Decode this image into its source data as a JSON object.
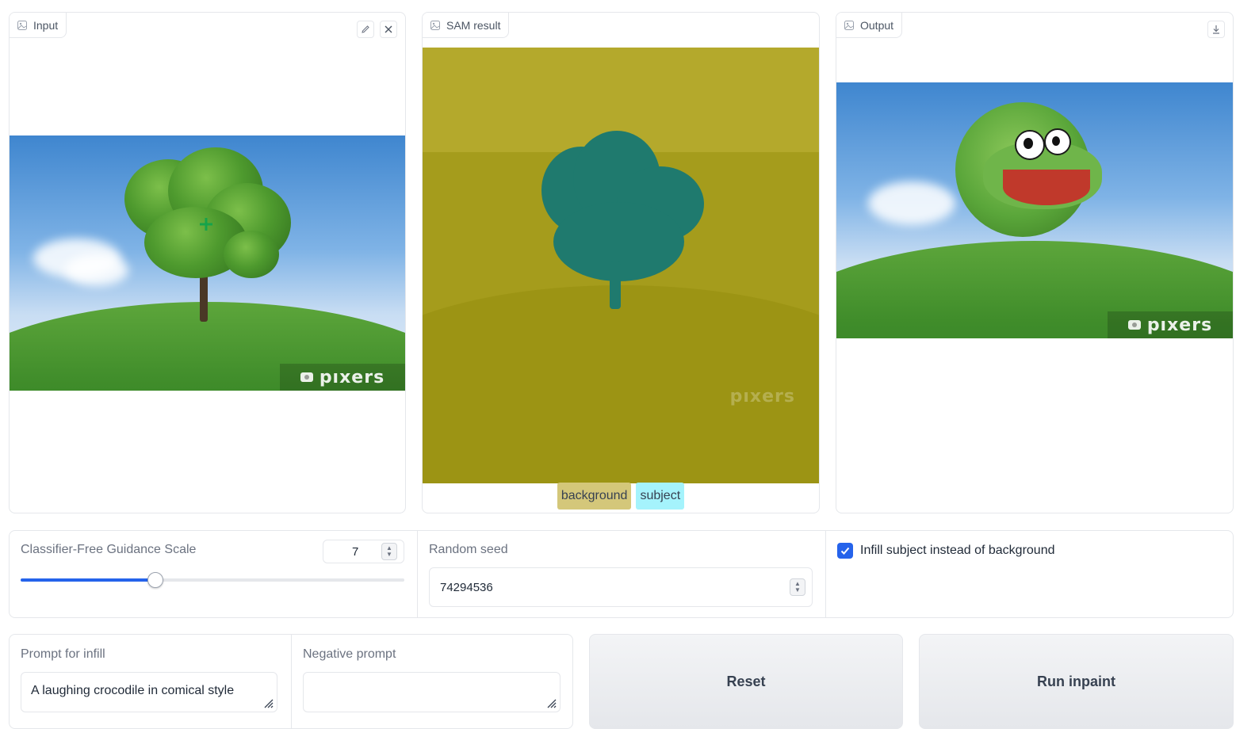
{
  "input_panel": {
    "label": "Input",
    "watermark": "pıxers"
  },
  "sam_panel": {
    "label": "SAM result",
    "watermark": "pıxers",
    "legend": [
      {
        "label": "background",
        "color": "#d4c77a"
      },
      {
        "label": "subject",
        "color": "#a5f3fc"
      }
    ]
  },
  "output_panel": {
    "label": "Output",
    "watermark": "pıxers"
  },
  "controls": {
    "cfg_label": "Classifier-Free Guidance Scale",
    "cfg_value": "7",
    "cfg_level": 0.35,
    "seed_label": "Random seed",
    "seed_value": "74294536",
    "infill_checkbox_label": "Infill subject instead of background",
    "infill_checked": true
  },
  "prompts": {
    "prompt_label": "Prompt for infill",
    "prompt_value": "A laughing crocodile in comical style",
    "negative_label": "Negative prompt",
    "negative_value": ""
  },
  "buttons": {
    "reset": "Reset",
    "run": "Run inpaint"
  },
  "colors": {
    "accent": "#2563eb",
    "sam_background": "#b4a92c",
    "sam_subject": "#1f7a6e"
  }
}
